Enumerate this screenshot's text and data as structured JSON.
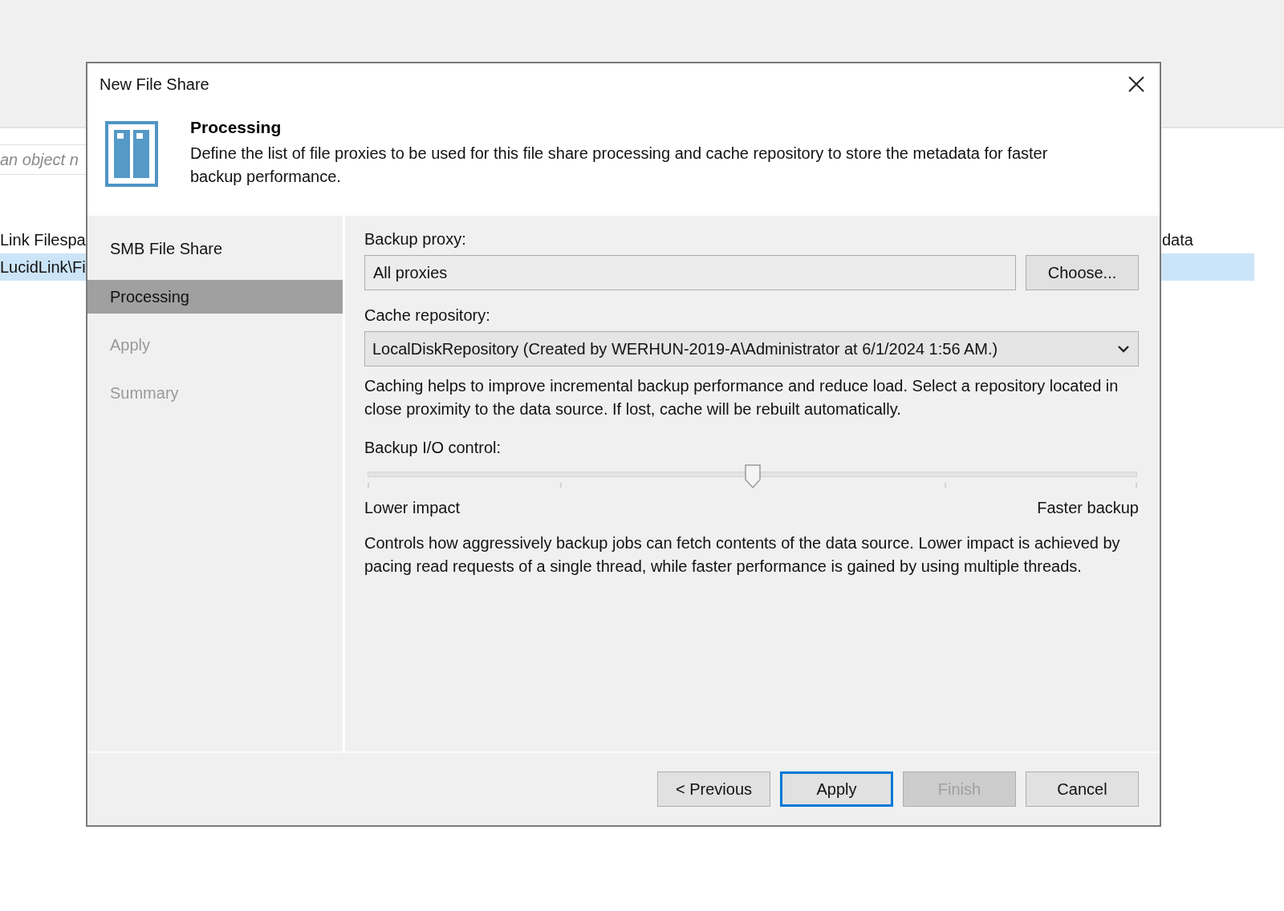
{
  "background": {
    "search": {
      "placeholder": "an object n"
    },
    "rows": [
      {
        "cells": [
          "Link Filespa",
          "data"
        ],
        "selected": false
      },
      {
        "cells": [
          "LucidLink\\Fi",
          ""
        ],
        "selected": true
      }
    ]
  },
  "window": {
    "title": "New File Share"
  },
  "header": {
    "title": "Processing",
    "description": "Define the list of file proxies to be used for this file share processing and cache repository to store the metadata for faster backup performance."
  },
  "steps": [
    {
      "label": "SMB File Share",
      "selected": false,
      "disabled": false
    },
    {
      "label": "Processing",
      "selected": true,
      "disabled": false
    },
    {
      "label": "Apply",
      "selected": false,
      "disabled": true
    },
    {
      "label": "Summary",
      "selected": false,
      "disabled": true
    }
  ],
  "backup_proxy": {
    "label": "Backup proxy:",
    "value": "All proxies",
    "button": "Choose..."
  },
  "cache_repository": {
    "label": "Cache repository:",
    "value": "LocalDiskRepository (Created by WERHUN-2019-A\\Administrator at 6/1/2024 1:56 AM.)",
    "hint": "Caching helps to improve incremental backup performance and reduce load. Select a repository located in close proximity to the data source. If lost, cache will be rebuilt automatically."
  },
  "io_control": {
    "label": "Backup I/O control:",
    "level": 0.5,
    "min_label": "Lower impact",
    "max_label": "Faster backup",
    "description": "Controls how aggressively backup jobs can fetch contents of the data source. Lower impact is achieved by pacing read requests of a single thread, while faster performance is gained by using multiple threads."
  },
  "buttons": [
    {
      "label": "< Previous",
      "default": false,
      "disabled": false
    },
    {
      "label": "Apply",
      "default": true,
      "disabled": false
    },
    {
      "label": "Finish",
      "default": false,
      "disabled": true
    },
    {
      "label": "Cancel",
      "default": false,
      "disabled": false
    }
  ]
}
